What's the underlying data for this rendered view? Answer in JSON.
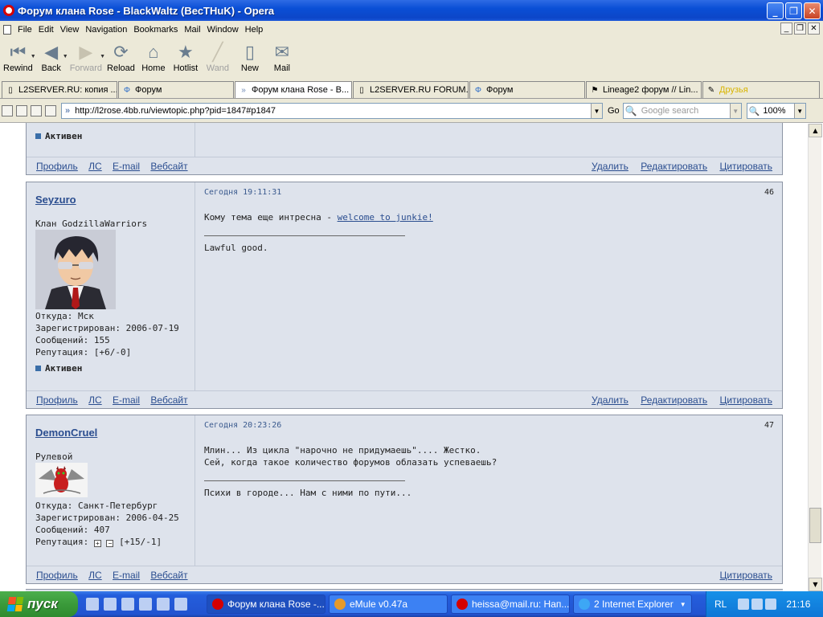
{
  "window": {
    "title": "Форум клана Rose - BlackWaltz (ВесТНuK) - Opera",
    "btn_min": "_",
    "btn_max": "❐",
    "btn_close": "✕"
  },
  "menu": {
    "items": [
      "File",
      "Edit",
      "View",
      "Navigation",
      "Bookmarks",
      "Mail",
      "Window",
      "Help"
    ]
  },
  "toolbar": {
    "rewind": "Rewind",
    "back": "Back",
    "forward": "Forward",
    "reload": "Reload",
    "home": "Home",
    "hotlist": "Hotlist",
    "wand": "Wand",
    "new": "New",
    "mail": "Mail"
  },
  "tabs": [
    {
      "label": "L2SERVER.RU: копия ..."
    },
    {
      "label": "Форум"
    },
    {
      "label": "Форум клана Rose - B..."
    },
    {
      "label": "L2SERVER.RU FORUM..."
    },
    {
      "label": "Форум"
    },
    {
      "label": "Lineage2 форум // Lin..."
    },
    {
      "label": "Друзья"
    }
  ],
  "address": {
    "url": "http://l2rose.4bb.ru/viewtopic.php?pid=1847#p1847",
    "go": "Go",
    "search_placeholder": "Google search",
    "zoom": "100%"
  },
  "common": {
    "active": "Активен",
    "profile": "Профиль",
    "pm": "ЛС",
    "email": "E-mail",
    "website": "Вебсайт",
    "delete": "Удалить",
    "edit": "Редактировать",
    "quote": "Цитировать"
  },
  "posts": [
    {
      "user": "Seyzuro",
      "title": "Клан GodzillaWarriors",
      "from": "Откуда: Мск",
      "registered": "Зарегистрирован: 2006-07-19",
      "messages": "Сообщений: 155",
      "reputation": "Репутация: [+6/-0]",
      "time": "Сегодня 19:11:31",
      "number": "46",
      "body_prefix": "Кому тема еще интресна - ",
      "body_link": "welcome to junkie!",
      "signature": "Lawful good."
    },
    {
      "user": "DemonCruel",
      "title": "Рулевой",
      "from": "Откуда: Санкт-Петербург",
      "registered": "Зарегистрирован: 2006-04-25",
      "messages": "Сообщений: 407",
      "reputation_label": "Репутация:",
      "reputation_value": "[+15/-1]",
      "time": "Сегодня 20:23:26",
      "number": "47",
      "body_line1": "Млин... Из цикла \"нарочно не придумаешь\".... Жестко.",
      "body_line2": "Сей, когда такое количество форумов облазать успеваешь?",
      "signature": "Психи в городе... Нам с ними по пути..."
    }
  ],
  "taskbar": {
    "start": "пуск",
    "tasks": [
      "Форум клана Rose -...",
      "eMule v0.47a",
      "heissa@mail.ru: Нап...",
      "2 Internet Explorer"
    ],
    "lang": "RL",
    "clock": "21:16"
  },
  "colors": {
    "link": "#2A4D8F",
    "post_bg": "#DEE3EC",
    "titlebar": "#0A4FD6"
  }
}
